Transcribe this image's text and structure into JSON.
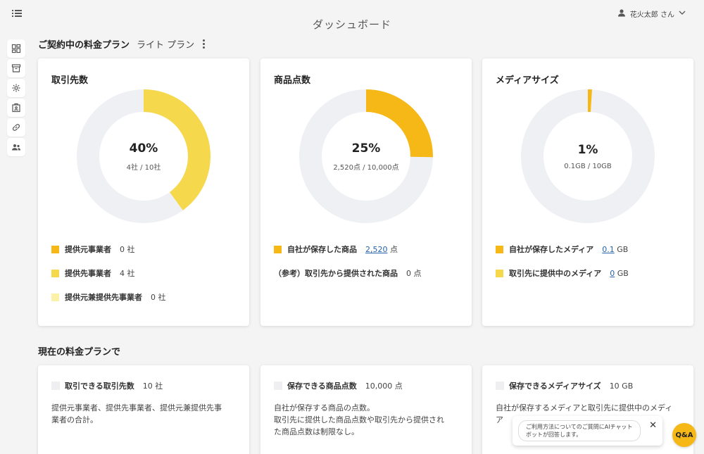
{
  "header": {
    "title": "ダッシュボード",
    "user_name": "花火太郎 さん"
  },
  "sidebar": {
    "icons": [
      "dashboard-icon",
      "archive-icon",
      "settings-icon",
      "badge-icon",
      "link-icon",
      "users-icon"
    ]
  },
  "plan": {
    "label": "ご契約中の料金プラン",
    "value": "ライト プラン"
  },
  "colors": {
    "dark_yellow": "#f6b817",
    "mid_yellow": "#f6d84c",
    "light_yellow": "#fbf2a8",
    "track": "#eff0f4",
    "link": "#2563a8"
  },
  "cards": [
    {
      "title": "取引先数",
      "percent": "40%",
      "sub": "4社 / 10社",
      "chart_data": {
        "type": "pie",
        "categories": [
          "提供元事業者",
          "提供先事業者",
          "提供元兼提供先事業者"
        ],
        "values": [
          0,
          4,
          0
        ],
        "total": 10
      },
      "legend": [
        {
          "name": "提供元事業者",
          "value": "0",
          "unit": "社",
          "color": "#f6b817"
        },
        {
          "name": "提供先事業者",
          "value": "4",
          "unit": "社",
          "color": "#f6d84c"
        },
        {
          "name": "提供元兼提供先事業者",
          "value": "0",
          "unit": "社",
          "color": "#fbf2a8"
        }
      ]
    },
    {
      "title": "商品点数",
      "percent": "25%",
      "sub": "2,520点 / 10,000点",
      "chart_data": {
        "type": "pie",
        "categories": [
          "自社が保存した商品"
        ],
        "values": [
          2520
        ],
        "total": 10000
      },
      "legend": [
        {
          "name": "自社が保存した商品",
          "value": "2,520",
          "unit": "点",
          "color": "#f6b817"
        },
        {
          "name": "（参考）取引先から提供された商品",
          "value": "0",
          "unit": "点"
        }
      ]
    },
    {
      "title": "メディアサイズ",
      "percent": "1%",
      "sub": "0.1GB / 10GB",
      "chart_data": {
        "type": "pie",
        "categories": [
          "自社が保存したメディア",
          "取引先に提供中のメディア"
        ],
        "values": [
          0.1,
          0
        ],
        "total": 10
      },
      "legend": [
        {
          "name": "自社が保存したメディア",
          "value": "0.1",
          "unit": "GB",
          "color": "#f6b817"
        },
        {
          "name": "取引先に提供中のメディア",
          "value": "0",
          "unit": "GB",
          "color": "#f6d84c"
        }
      ]
    }
  ],
  "current_plan": {
    "title": "現在の料金プランで",
    "items": [
      {
        "name": "取引できる取引先数",
        "value": "10 社",
        "desc": [
          "提供元事業者、提供先事業者、提供元兼提供先事",
          "業者の合計。"
        ]
      },
      {
        "name": "保存できる商品点数",
        "value": "10,000 点",
        "desc": [
          "自社が保存する商品の点数。",
          "取引先に提供した商品点数や取引先から提供され",
          "た商品点数は制限なし。"
        ]
      },
      {
        "name": "保存できるメディアサイズ",
        "value": "10 GB",
        "desc": [
          "自社が保存するメディアと取引先に提供中のメディ",
          "ア"
        ]
      }
    ]
  },
  "chat": {
    "line1": "ご利用方法についてのご質問にAIチャット",
    "line2": "ボットが回答します。",
    "qa_label": "Q&A"
  }
}
